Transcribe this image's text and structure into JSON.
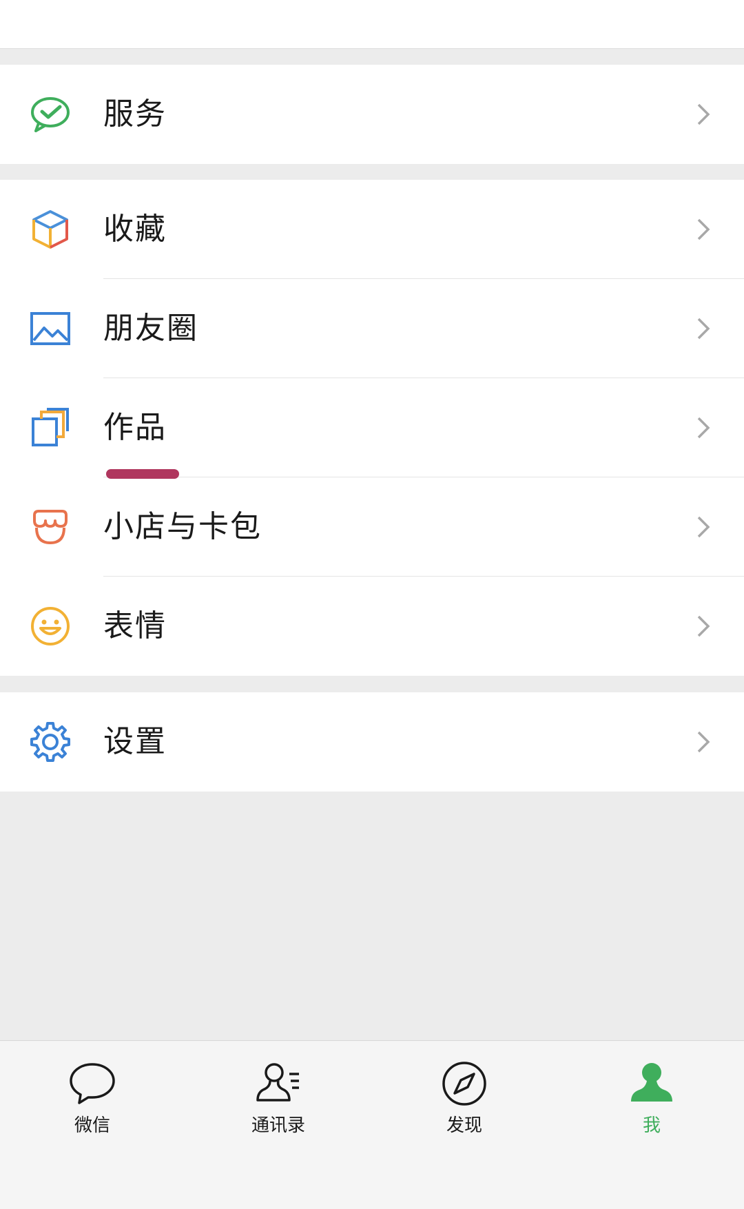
{
  "menu": {
    "groups": [
      {
        "items": [
          {
            "label": "服务",
            "icon": "wechat-pay-icon"
          }
        ]
      },
      {
        "items": [
          {
            "label": "收藏",
            "icon": "favorites-cube-icon"
          },
          {
            "label": "朋友圈",
            "icon": "moments-image-icon"
          },
          {
            "label": "作品",
            "icon": "works-copy-icon"
          },
          {
            "label": "小店与卡包",
            "icon": "shop-card-icon"
          },
          {
            "label": "表情",
            "icon": "sticker-smile-icon"
          }
        ]
      },
      {
        "items": [
          {
            "label": "设置",
            "icon": "settings-gear-icon"
          }
        ]
      }
    ]
  },
  "tabbar": {
    "tabs": [
      {
        "label": "微信",
        "icon": "chat-bubble-icon",
        "active": false
      },
      {
        "label": "通讯录",
        "icon": "contacts-icon",
        "active": false
      },
      {
        "label": "发现",
        "icon": "discover-compass-icon",
        "active": false
      },
      {
        "label": "我",
        "icon": "me-person-icon",
        "active": true
      }
    ]
  },
  "colors": {
    "accent_green": "#3fae5c",
    "annotation_mark": "#b0365e",
    "page_background": "#ececec"
  }
}
